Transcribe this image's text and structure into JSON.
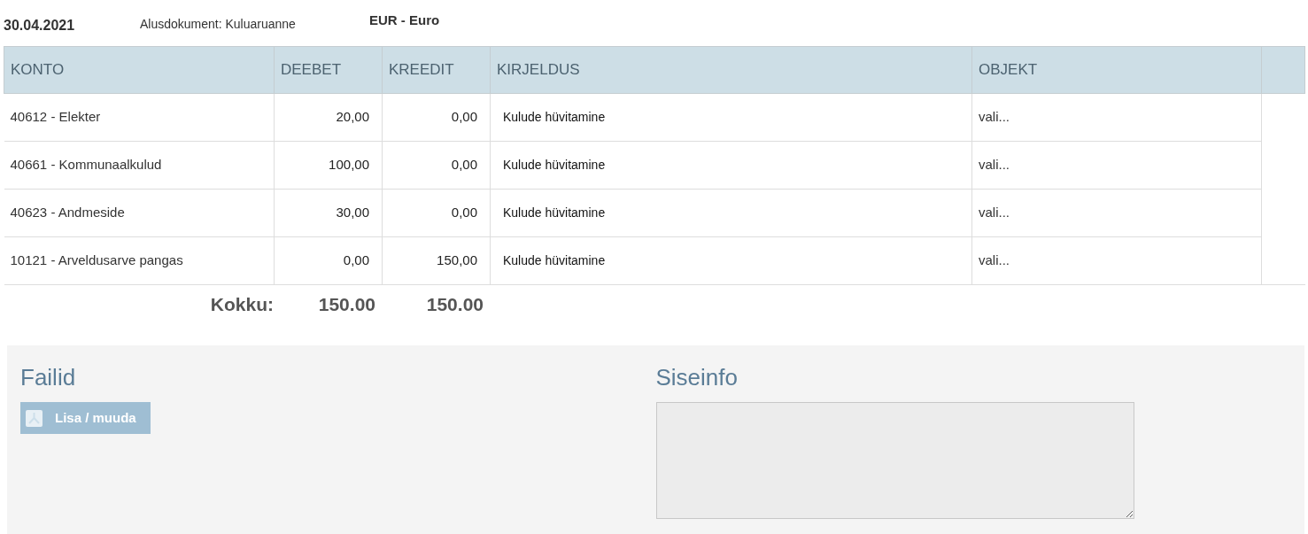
{
  "header": {
    "date": "30.04.2021",
    "base_document": "Alusdokument: Kuluaruanne",
    "currency": "EUR - Euro"
  },
  "table": {
    "columns": [
      "KONTO",
      "DEEBET",
      "KREEDIT",
      "KIRJELDUS",
      "OBJEKT"
    ],
    "rows": [
      {
        "account": "40612 - Elekter",
        "debit": "20,00",
        "credit": "0,00",
        "description": "Kulude hüvitamine",
        "object": "vali..."
      },
      {
        "account": "40661 - Kommunaalkulud",
        "debit": "100,00",
        "credit": "0,00",
        "description": "Kulude hüvitamine",
        "object": "vali..."
      },
      {
        "account": "40623 - Andmeside",
        "debit": "30,00",
        "credit": "0,00",
        "description": "Kulude hüvitamine",
        "object": "vali..."
      },
      {
        "account": "10121 - Arveldusarve pangas",
        "debit": "0,00",
        "credit": "150,00",
        "description": "Kulude hüvitamine",
        "object": "vali..."
      }
    ],
    "totals": {
      "label": "Kokku:",
      "debit": "150.00",
      "credit": "150.00"
    }
  },
  "files": {
    "title": "Failid",
    "button": {
      "label": "Lisa / muuda",
      "disabled": true
    }
  },
  "internal_info": {
    "title": "Siseinfo"
  }
}
